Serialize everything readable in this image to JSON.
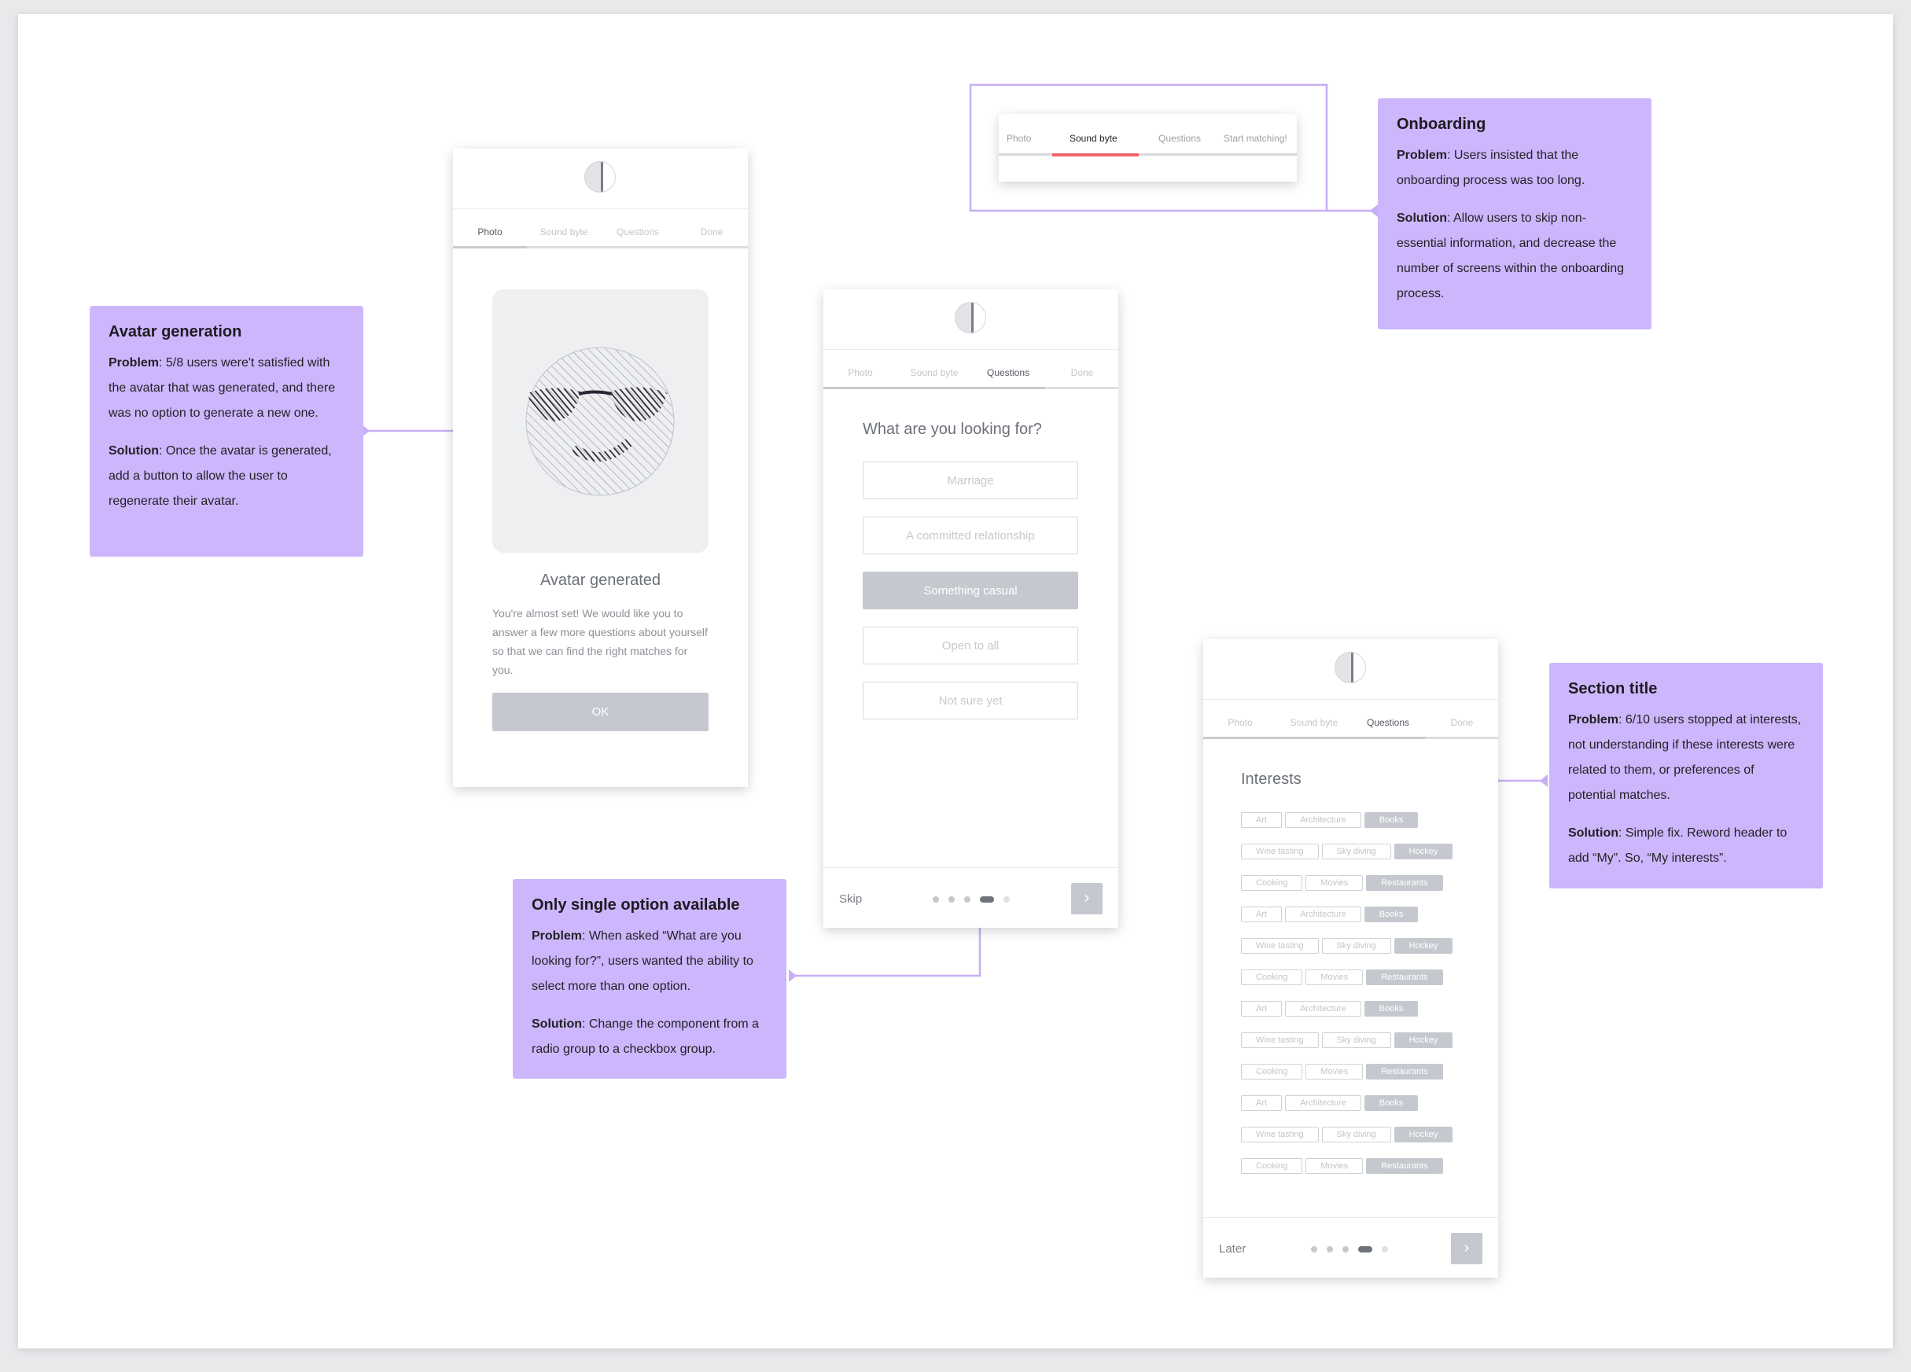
{
  "onboarding_tabs": {
    "labels": [
      "Photo",
      "Sound byte",
      "Questions",
      "Start matching!"
    ],
    "active_index": 1,
    "accent_color": "#f06464"
  },
  "phone1": {
    "tabs": [
      "Photo",
      "Sound byte",
      "Questions",
      "Done"
    ],
    "title": "Avatar generated",
    "body": "You're almost set! We would like you to answer a few more questions about yourself so that we can find the right matches for you.",
    "ok_label": "OK"
  },
  "phone2": {
    "tabs": [
      "Photo",
      "Sound byte",
      "Questions",
      "Done"
    ],
    "question": "What are you looking for?",
    "options": [
      "Marriage",
      "A committed relationship",
      "Something casual",
      "Open to all",
      "Not sure yet"
    ],
    "selected_option": "Something casual",
    "skip_label": "Skip",
    "next_icon": "chevron-right-icon",
    "progress_step": 4,
    "progress_total": 5
  },
  "phone3": {
    "tabs": [
      "Photo",
      "Sound byte",
      "Questions",
      "Done"
    ],
    "title": "Interests",
    "chip_rows": [
      [
        {
          "t": "Art",
          "s": false
        },
        {
          "t": "Architecture",
          "s": false
        },
        {
          "t": "Books",
          "s": true
        }
      ],
      [
        {
          "t": "Wine tasting",
          "s": false
        },
        {
          "t": "Sky diving",
          "s": false
        },
        {
          "t": "Hockey",
          "s": true
        }
      ],
      [
        {
          "t": "Cooking",
          "s": false
        },
        {
          "t": "Movies",
          "s": false
        },
        {
          "t": "Restaurants",
          "s": true
        }
      ],
      [
        {
          "t": "Art",
          "s": false
        },
        {
          "t": "Architecture",
          "s": false
        },
        {
          "t": "Books",
          "s": true
        }
      ],
      [
        {
          "t": "Wine tasting",
          "s": false
        },
        {
          "t": "Sky diving",
          "s": false
        },
        {
          "t": "Hockey",
          "s": true
        }
      ],
      [
        {
          "t": "Cooking",
          "s": false
        },
        {
          "t": "Movies",
          "s": false
        },
        {
          "t": "Restaurants",
          "s": true
        }
      ],
      [
        {
          "t": "Art",
          "s": false
        },
        {
          "t": "Architecture",
          "s": false
        },
        {
          "t": "Books",
          "s": true
        }
      ],
      [
        {
          "t": "Wine tasting",
          "s": false
        },
        {
          "t": "Sky diving",
          "s": false
        },
        {
          "t": "Hockey",
          "s": true
        }
      ],
      [
        {
          "t": "Cooking",
          "s": false
        },
        {
          "t": "Movies",
          "s": false
        },
        {
          "t": "Restaurants",
          "s": true
        }
      ],
      [
        {
          "t": "Art",
          "s": false
        },
        {
          "t": "Architecture",
          "s": false
        },
        {
          "t": "Books",
          "s": true
        }
      ],
      [
        {
          "t": "Wine tasting",
          "s": false
        },
        {
          "t": "Sky diving",
          "s": false
        },
        {
          "t": "Hockey",
          "s": true
        }
      ],
      [
        {
          "t": "Cooking",
          "s": false
        },
        {
          "t": "Movies",
          "s": false
        },
        {
          "t": "Restaurants",
          "s": true
        }
      ]
    ],
    "later_label": "Later",
    "next_icon": "chevron-right-icon",
    "progress_step": 4,
    "progress_total": 5
  },
  "notes": {
    "avatar": {
      "title": "Avatar generation",
      "problem_label": "Problem",
      "problem": ": 5/8 users were't satisfied with the avatar that was generated, and there was no option to generate a new one.",
      "solution_label": "Solution",
      "solution": ": Once the avatar is generated, add a button to allow the user to regenerate their avatar."
    },
    "onboarding": {
      "title": "Onboarding",
      "problem_label": "Problem",
      "problem": ": Users insisted that the onboarding process was too long.",
      "solution_label": "Solution",
      "solution": ": Allow users to skip non-essential information, and decrease the number of screens within the onboarding process."
    },
    "single_option": {
      "title": "Only single option available",
      "problem_label": "Problem",
      "problem": ": When asked “What are you looking for?”, users wanted the ability to select more than one option.",
      "solution_label": "Solution",
      "solution": ": Change the component from a radio group to a checkbox group."
    },
    "section_title": {
      "title": "Section title",
      "problem_label": "Problem",
      "problem": ": 6/10 users stopped at interests, not understanding if these interests were related to them, or preferences of potential matches.",
      "solution_label": "Solution",
      "solution": ": Simple fix. Reword header to add “My”. So, “My interests”."
    }
  },
  "colors": {
    "note_bg": "#cdb6fb",
    "connector": "#c7aef5",
    "avatar_stroke": "#2a2633"
  }
}
